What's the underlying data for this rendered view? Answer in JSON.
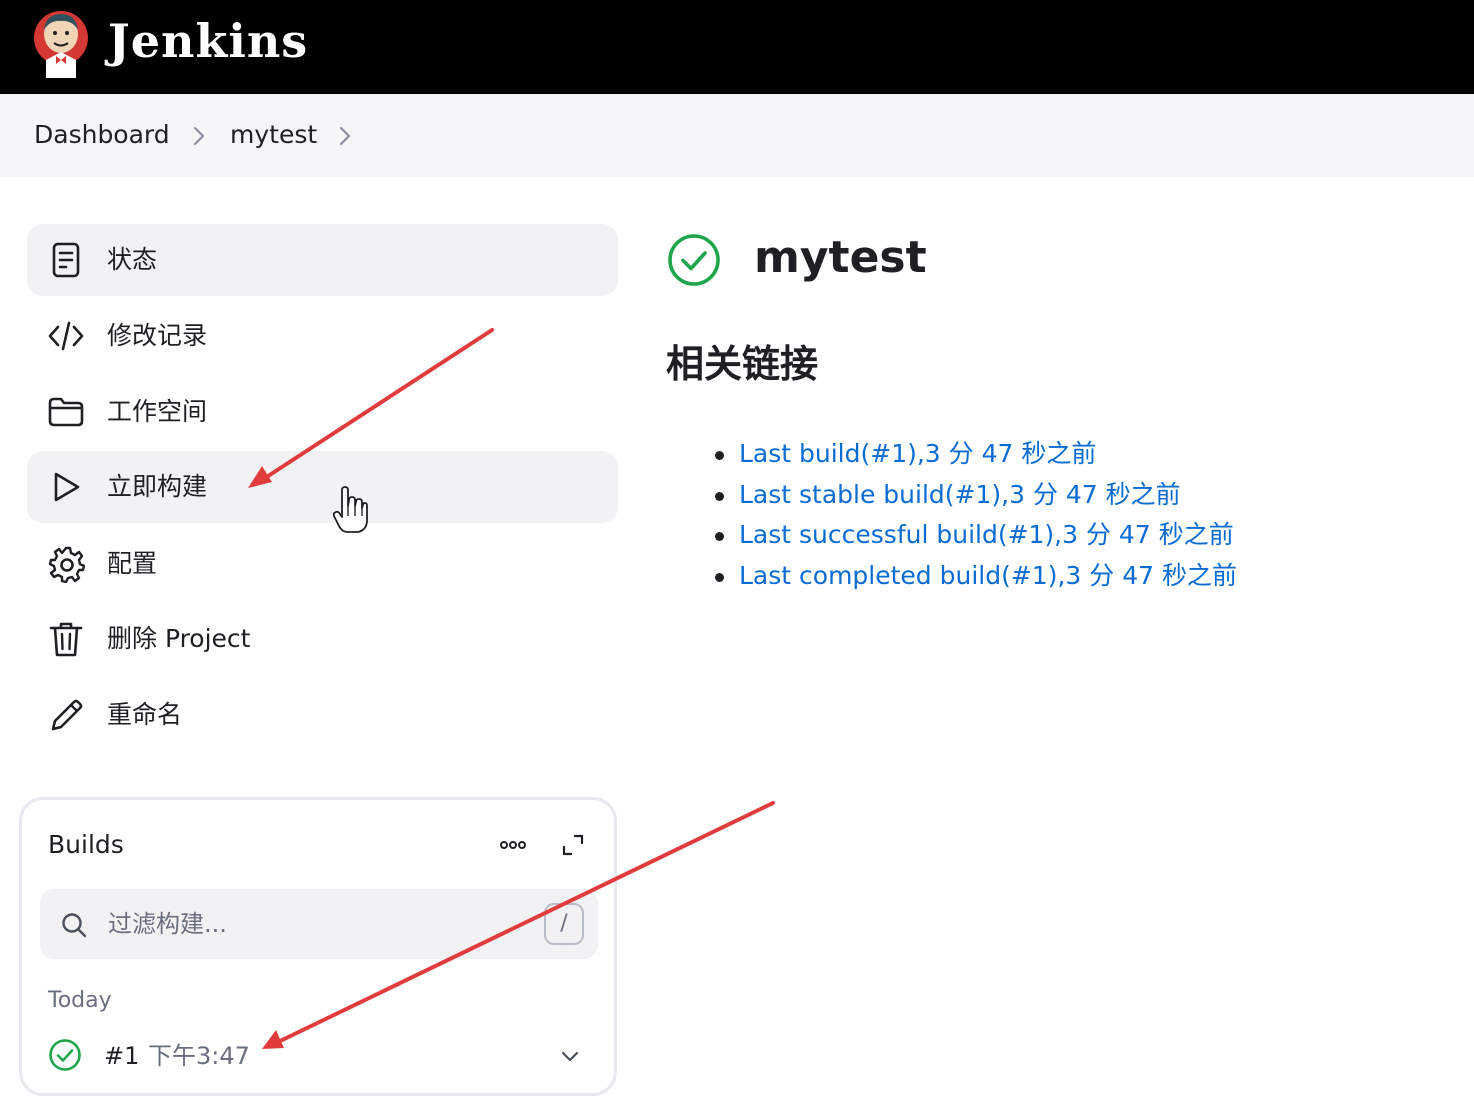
{
  "header": {
    "brand": "Jenkins",
    "logo_icon": "jenkins-butler-logo"
  },
  "breadcrumb": {
    "items": [
      "Dashboard",
      "mytest"
    ],
    "separator_icon": "chevron-right-icon"
  },
  "sidebar": {
    "items": [
      {
        "label": "状态",
        "icon": "document-icon",
        "state": "active"
      },
      {
        "label": "修改记录",
        "icon": "code-icon"
      },
      {
        "label": "工作空间",
        "icon": "folder-icon"
      },
      {
        "label": "立即构建",
        "icon": "play-icon",
        "state": "hover"
      },
      {
        "label": "配置",
        "icon": "gear-icon"
      },
      {
        "label": "删除 Project",
        "icon": "trash-icon"
      },
      {
        "label": "重命名",
        "icon": "pencil-icon"
      }
    ]
  },
  "builds": {
    "title": "Builds",
    "search_placeholder": "过滤构建...",
    "search_shortcut": "/",
    "group_label": "Today",
    "items": [
      {
        "number": "#1",
        "time": "下午3:47",
        "status": "success"
      }
    ]
  },
  "main": {
    "title": "mytest",
    "status": "success",
    "status_color": "#1ea64b",
    "section_heading": "相关链接",
    "links": [
      "Last build(#1),3 分 47 秒之前",
      "Last stable build(#1),3 分 47 秒之前",
      "Last successful build(#1),3 分 47 秒之前",
      "Last completed build(#1),3 分 47 秒之前"
    ]
  },
  "colors": {
    "link": "#0a6cd2",
    "annotation_arrow": "#e03c3c",
    "success": "#1ea64b",
    "header_bg": "#000000"
  }
}
